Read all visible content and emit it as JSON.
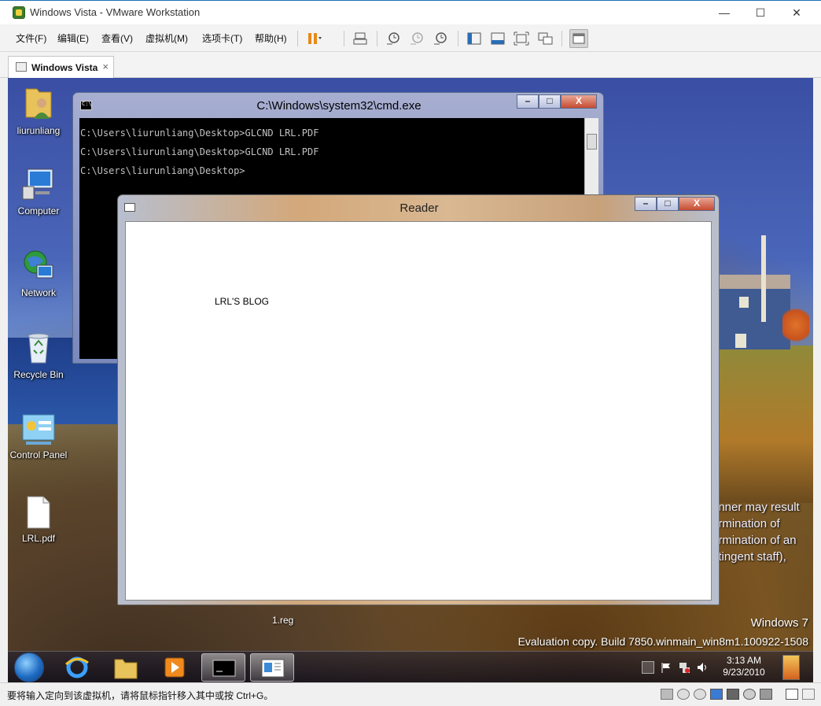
{
  "host": {
    "title": "Windows Vista - VMware Workstation",
    "controls": {
      "minimize": "—",
      "maximize": "☐",
      "close": "✕"
    },
    "menu": [
      "文件(F)",
      "编辑(E)",
      "查看(V)",
      "虚拟机(M)",
      "选项卡(T)",
      "帮助(H)"
    ],
    "tab": {
      "label": "Windows Vista",
      "close": "×"
    },
    "status_text": "要将输入定向到该虚拟机，请将鼠标指针移入其中或按 Ctrl+G。"
  },
  "desktop": {
    "icons": [
      {
        "label": "liurunliang",
        "icon": "user-folder-icon"
      },
      {
        "label": "Computer",
        "icon": "computer-icon"
      },
      {
        "label": "Network",
        "icon": "network-icon"
      },
      {
        "label": "Recycle Bin",
        "icon": "recycle-bin-icon"
      },
      {
        "label": "Control Panel",
        "icon": "control-panel-icon"
      },
      {
        "label": "LRL.pdf",
        "icon": "pdf-file-icon"
      }
    ],
    "reg_file_label": "1.reg",
    "bg_text_lines": [
      "anner may result",
      "ermination of",
      "ermination of an",
      "ntingent staff),"
    ],
    "watermark_line1": "Windows 7",
    "watermark_line2": "Evaluation copy. Build 7850.winmain_win8m1.100922-1508"
  },
  "cmd": {
    "title": "C:\\Windows\\system32\\cmd.exe",
    "lines": [
      "C:\\Users\\liurunliang\\Desktop>GLCND LRL.PDF",
      "C:\\Users\\liurunliang\\Desktop>GLCND LRL.PDF",
      "C:\\Users\\liurunliang\\Desktop>"
    ]
  },
  "reader": {
    "title": "Reader",
    "content_text": "LRL'S BLOG"
  },
  "taskbar": {
    "clock_time": "3:13 AM",
    "clock_date": "9/23/2010"
  }
}
